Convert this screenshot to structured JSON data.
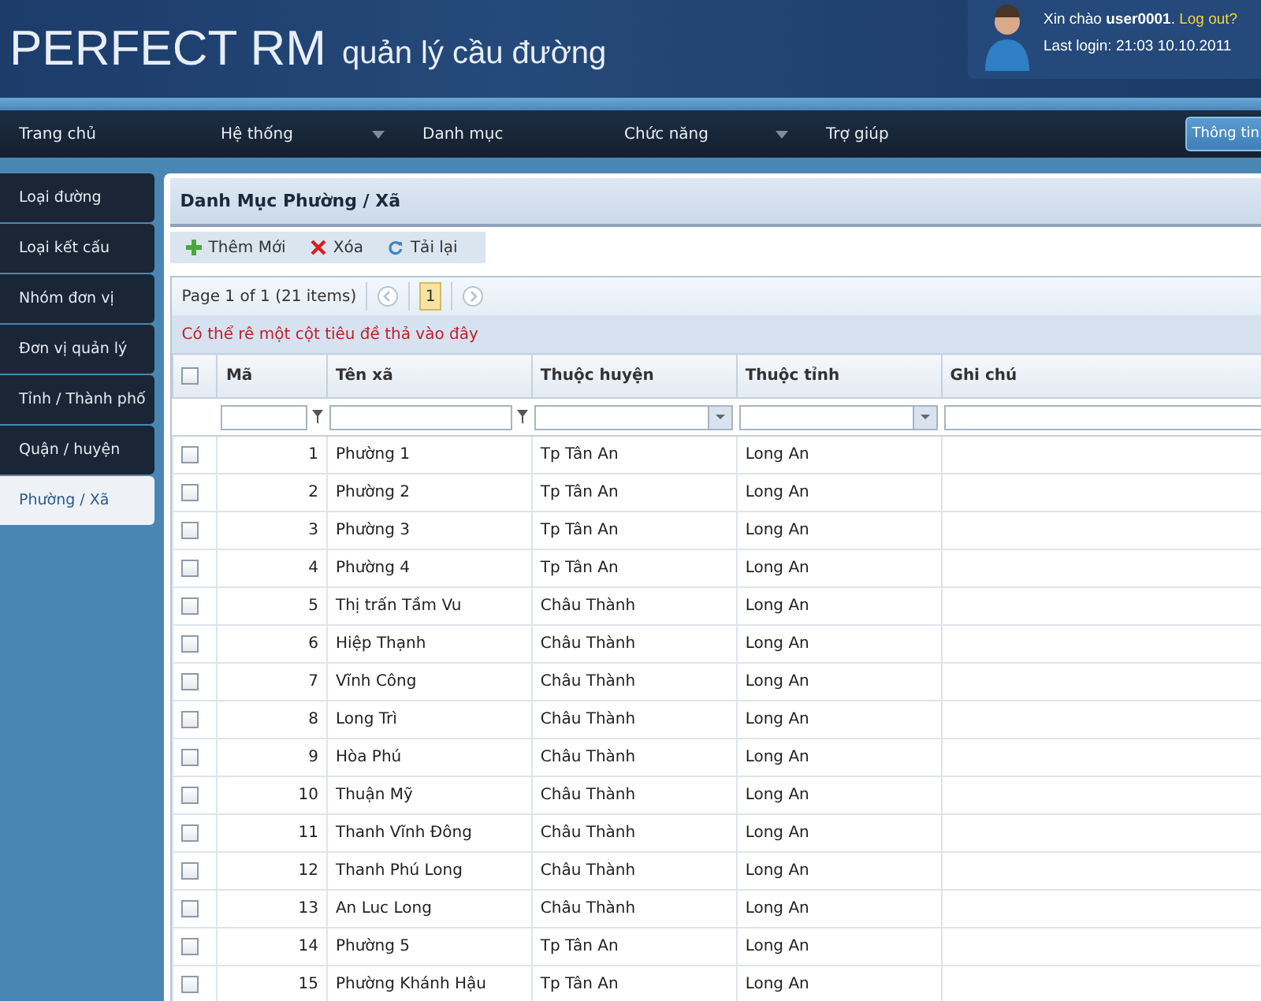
{
  "header": {
    "brand": "PERFECT RM",
    "subtitle": "quản lý cầu đường",
    "greeting": "Xin chào ",
    "username": "user0001",
    "separator": ". ",
    "logout": "Log out?",
    "last_login": "Last login: 21:03 10.10.2011"
  },
  "nav": {
    "items": [
      {
        "label": "Trang chủ",
        "has_dropdown": false
      },
      {
        "label": "Hệ thống",
        "has_dropdown": true
      },
      {
        "label": "Danh mục",
        "has_dropdown": false
      },
      {
        "label": "Chức năng",
        "has_dropdown": true
      },
      {
        "label": "Trợ giúp",
        "has_dropdown": false
      }
    ],
    "button": "Thông tin"
  },
  "sidebar": {
    "items": [
      {
        "label": "Loại đường",
        "selected": false
      },
      {
        "label": "Loại kết cấu",
        "selected": false
      },
      {
        "label": "Nhóm đơn vị",
        "selected": false
      },
      {
        "label": "Đơn vị quản lý",
        "selected": false
      },
      {
        "label": "Tỉnh / Thành phố",
        "selected": false
      },
      {
        "label": "Quận / huyện",
        "selected": false
      },
      {
        "label": "Phường / Xã",
        "selected": true
      }
    ]
  },
  "panel": {
    "title": "Danh Mục Phường / Xã",
    "toolbar": [
      {
        "kind": "add",
        "label": "Thêm Mới"
      },
      {
        "kind": "delete",
        "label": "Xóa"
      },
      {
        "kind": "reload",
        "label": "Tải lại"
      }
    ],
    "pager": {
      "summary": "Page 1 of 1 (21 items)",
      "pages": [
        {
          "label": "1",
          "selected": true
        }
      ]
    },
    "group_hint": "Có thể rê một cột tiêu đề thả vào đây",
    "table": {
      "select_all_checked": false,
      "columns": [
        {
          "label": "Mã",
          "kind": "textfilter"
        },
        {
          "label": "Tên xã",
          "kind": "textfilter"
        },
        {
          "label": "Thuộc huyện",
          "kind": "selectfilter"
        },
        {
          "label": "Thuộc tỉnh",
          "kind": "selectfilter"
        },
        {
          "label": "Ghi chú",
          "kind": "plainfilter"
        }
      ],
      "rows": [
        {
          "checked": false,
          "cells": [
            "1",
            "Phường 1",
            "Tp Tân An",
            "Long An"
          ]
        },
        {
          "checked": false,
          "cells": [
            "2",
            "Phường 2",
            "Tp Tân An",
            "Long An"
          ]
        },
        {
          "checked": false,
          "cells": [
            "3",
            "Phường 3",
            "Tp Tân An",
            "Long An"
          ]
        },
        {
          "checked": false,
          "cells": [
            "4",
            "Phường 4",
            "Tp Tân An",
            "Long An"
          ]
        },
        {
          "checked": false,
          "cells": [
            "5",
            "Thị trấn Tầm Vu",
            "Châu Thành",
            "Long An"
          ]
        },
        {
          "checked": false,
          "cells": [
            "6",
            "Hiệp Thạnh",
            "Châu Thành",
            "Long An"
          ]
        },
        {
          "checked": false,
          "cells": [
            "7",
            "Vĩnh Công",
            "Châu Thành",
            "Long An"
          ]
        },
        {
          "checked": false,
          "cells": [
            "8",
            "Long Trì",
            "Châu Thành",
            "Long An"
          ]
        },
        {
          "checked": false,
          "cells": [
            "9",
            "Hòa Phú",
            "Châu Thành",
            "Long An"
          ]
        },
        {
          "checked": false,
          "cells": [
            "10",
            "Thuận Mỹ",
            "Châu Thành",
            "Long An"
          ]
        },
        {
          "checked": false,
          "cells": [
            "11",
            "Thanh Vĩnh Đông",
            "Châu Thành",
            "Long An"
          ]
        },
        {
          "checked": false,
          "cells": [
            "12",
            "Thanh Phú Long",
            "Châu Thành",
            "Long An"
          ]
        },
        {
          "checked": false,
          "cells": [
            "13",
            "An Luc Long",
            "Châu Thành",
            "Long An"
          ]
        },
        {
          "checked": false,
          "cells": [
            "14",
            "Phường 5",
            "Tp Tân An",
            "Long An"
          ]
        },
        {
          "checked": false,
          "cells": [
            "15",
            "Phường Khánh Hậu",
            "Tp Tân An",
            "Long An"
          ]
        }
      ]
    }
  }
}
